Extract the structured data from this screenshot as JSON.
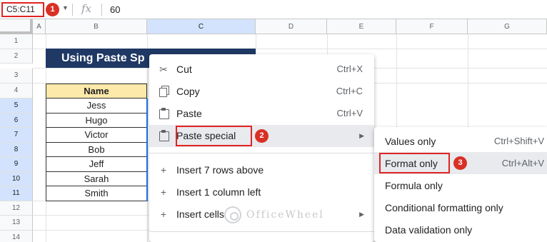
{
  "formula_bar": {
    "name_box": "C5:C11",
    "fx_label": "fx",
    "value": "60"
  },
  "badges": [
    "1",
    "2",
    "3"
  ],
  "columns": [
    "A",
    "B",
    "C",
    "D",
    "E",
    "F",
    "G"
  ],
  "rows": [
    "1",
    "2",
    "3",
    "4",
    "5",
    "6",
    "7",
    "8",
    "9",
    "10",
    "11",
    "12",
    "13",
    "14"
  ],
  "sheet": {
    "title": "Using Paste Sp",
    "name_header": "Name",
    "names": [
      "Jess",
      "Hugo",
      "Victor",
      "Bob",
      "Jeff",
      "Sarah",
      "Smith"
    ]
  },
  "context_menu": {
    "items": [
      {
        "label": "Cut",
        "shortcut": "Ctrl+X",
        "icon": "scissors-icon"
      },
      {
        "label": "Copy",
        "shortcut": "Ctrl+C",
        "icon": "copy-icon"
      },
      {
        "label": "Paste",
        "shortcut": "Ctrl+V",
        "icon": "paste-icon"
      },
      {
        "label": "Paste special",
        "shortcut": "",
        "icon": "paste-special-icon"
      },
      {
        "label": "Insert 7 rows above",
        "shortcut": "",
        "icon": "plus-icon"
      },
      {
        "label": "Insert 1 column left",
        "shortcut": "",
        "icon": "plus-icon"
      },
      {
        "label": "Insert cells",
        "shortcut": "",
        "icon": "plus-icon"
      }
    ]
  },
  "submenu": {
    "items": [
      {
        "label": "Values only",
        "shortcut": "Ctrl+Shift+V"
      },
      {
        "label": "Format only",
        "shortcut": "Ctrl+Alt+V"
      },
      {
        "label": "Formula only",
        "shortcut": ""
      },
      {
        "label": "Conditional formatting only",
        "shortcut": ""
      },
      {
        "label": "Data validation only",
        "shortcut": ""
      }
    ]
  },
  "watermark": "OfficeWheel",
  "colors": {
    "title_bg": "#1f3864",
    "header_bg": "#fde9a9",
    "highlight_red": "#e02424",
    "badge_red": "#d93025",
    "selection_blue": "#1a73e8"
  }
}
